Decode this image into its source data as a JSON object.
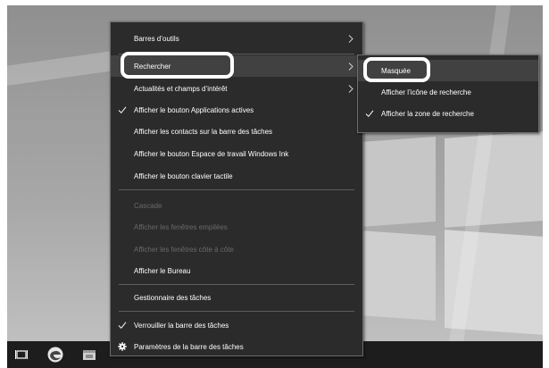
{
  "main_menu": {
    "items": [
      {
        "label": "Barres d’outils",
        "submenu": true
      },
      {
        "label": "Rechercher",
        "submenu": true,
        "highlighted": true
      },
      {
        "label": "Actualités et champs d’intérêt",
        "submenu": true
      },
      {
        "label": "Afficher le bouton Applications actives",
        "checked": true
      },
      {
        "label": "Afficher les contacts sur la barre des tâches"
      },
      {
        "label": "Afficher le bouton Espace de travail Windows Ink"
      },
      {
        "label": "Afficher le bouton clavier tactile"
      },
      {
        "label": "Cascade",
        "disabled": true
      },
      {
        "label": "Afficher les fenêtres empilées",
        "disabled": true
      },
      {
        "label": "Afficher les fenêtres côte à côte",
        "disabled": true
      },
      {
        "label": "Afficher le Bureau"
      },
      {
        "label": "Gestionnaire des tâches"
      },
      {
        "label": "Verrouiller la barre des tâches",
        "checked": true
      },
      {
        "label": "Paramètres de la barre des tâches",
        "icon": "gear-icon"
      }
    ]
  },
  "search_submenu": {
    "items": [
      {
        "label": "Masquée",
        "highlighted": true
      },
      {
        "label": "Afficher l’icône de recherche"
      },
      {
        "label": "Afficher la zone de recherche",
        "checked": true
      }
    ]
  },
  "taskbar": {
    "icons": [
      "task-view-icon",
      "edge-icon",
      "file-explorer-icon"
    ]
  },
  "colors": {
    "menu_bg": "#2b2b2b",
    "menu_highlight": "#414141",
    "menu_text": "#ffffff",
    "menu_disabled_text": "#6a6a6a",
    "taskbar_bg": "#1d1d1d",
    "callout_ring": "#ffffff"
  }
}
